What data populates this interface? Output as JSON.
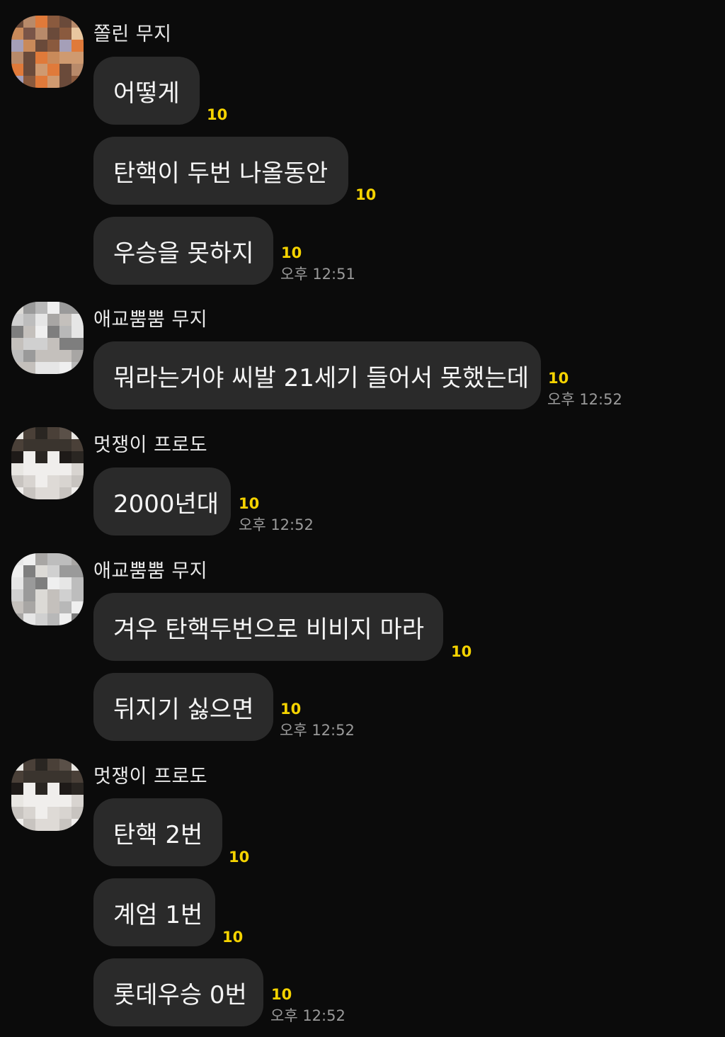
{
  "groups": [
    {
      "name": "쫄린 무지",
      "messages": [
        {
          "text": "어떻게",
          "unread": "10"
        },
        {
          "text": "탄핵이 두번 나올동안",
          "unread": "10"
        },
        {
          "text": "우승을 못하지",
          "unread": "10",
          "time": "오후 12:51"
        }
      ]
    },
    {
      "name": "애교뿜뿜 무지",
      "messages": [
        {
          "text": "뭐라는거야 씨발 21세기 들어서 못했는데",
          "unread": "10",
          "time": "오후 12:52"
        }
      ]
    },
    {
      "name": "멋쟁이 프로도",
      "messages": [
        {
          "text": "2000년대",
          "unread": "10",
          "time": "오후 12:52"
        }
      ]
    },
    {
      "name": "애교뿜뿜 무지",
      "messages": [
        {
          "text": "겨우 탄핵두번으로 비비지 마라",
          "unread": "10"
        },
        {
          "text": "뒤지기 싫으면",
          "unread": "10",
          "time": "오후 12:52"
        }
      ]
    },
    {
      "name": "멋쟁이 프로도",
      "messages": [
        {
          "text": "탄핵 2번",
          "unread": "10"
        },
        {
          "text": "계엄 1번",
          "unread": "10"
        },
        {
          "text": "롯데우승 0번",
          "unread": "10",
          "time": "오후 12:52"
        }
      ]
    }
  ],
  "colors": {
    "background": "#0b0b0b",
    "bubble": "#2a2a2a",
    "unread": "#f5d300",
    "time": "#9a9a9a"
  }
}
